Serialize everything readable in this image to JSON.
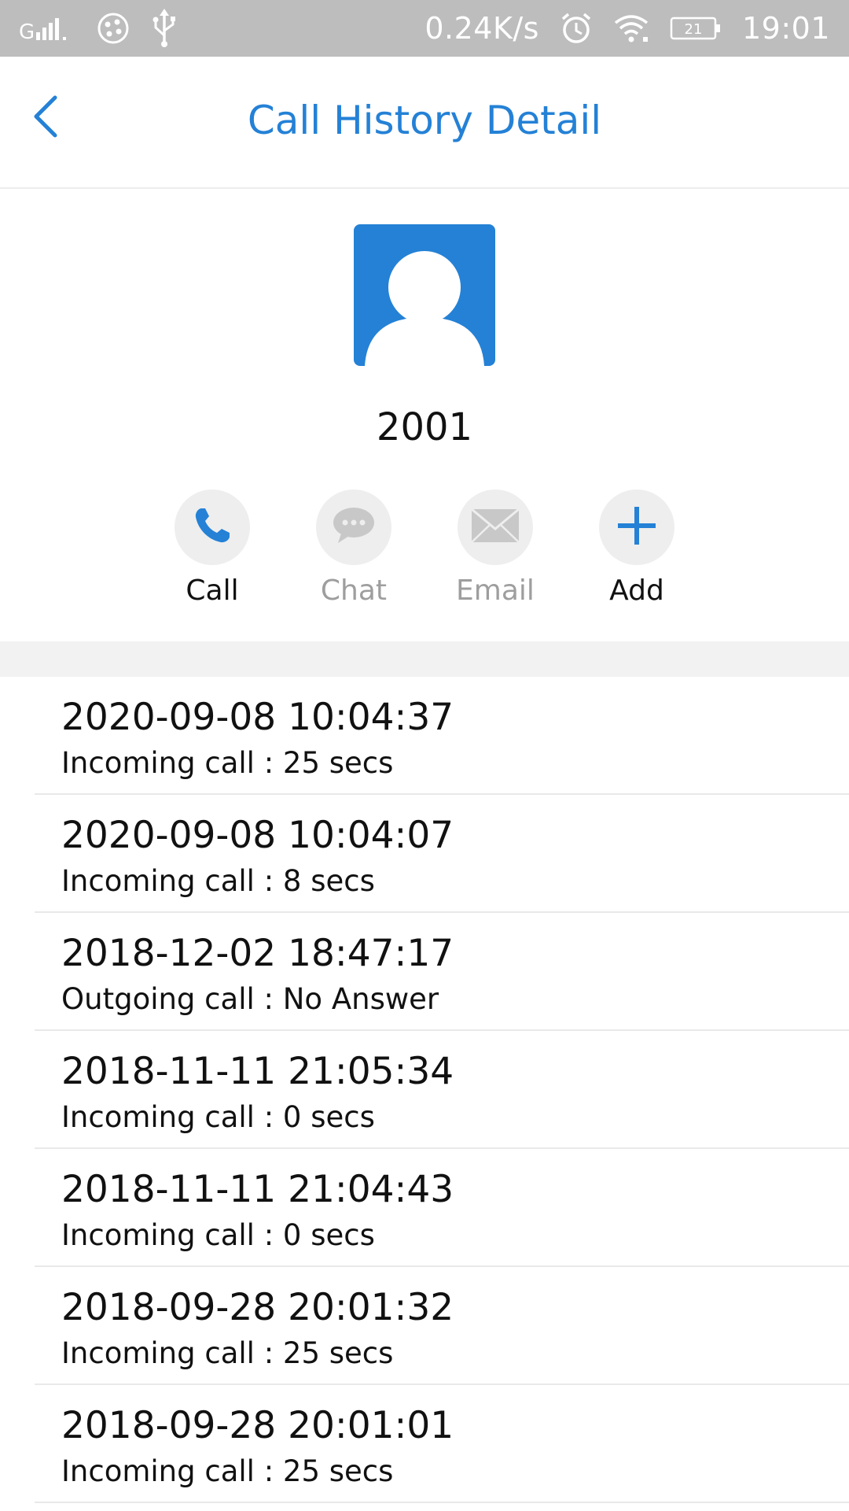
{
  "status_bar": {
    "signal_icon": "signal-icon",
    "app_icon": "app-notification-icon",
    "usb_icon": "usb-icon",
    "net_speed": "0.24K/s",
    "alarm_icon": "alarm-icon",
    "wifi_icon": "wifi-icon",
    "battery_level": "21",
    "time": "19:01"
  },
  "header": {
    "back_icon": "back-chevron-icon",
    "title": "Call History Detail"
  },
  "contact": {
    "avatar_icon": "person-avatar-icon",
    "name": "2001"
  },
  "actions": [
    {
      "label": "Call",
      "icon": "phone-icon",
      "enabled": true
    },
    {
      "label": "Chat",
      "icon": "chat-bubble-icon",
      "enabled": false
    },
    {
      "label": "Email",
      "icon": "envelope-icon",
      "enabled": false
    },
    {
      "label": "Add",
      "icon": "plus-icon",
      "enabled": true
    }
  ],
  "history": [
    {
      "datetime": "2020-09-08 10:04:37",
      "detail": "Incoming call : 25 secs"
    },
    {
      "datetime": "2020-09-08 10:04:07",
      "detail": "Incoming call : 8 secs"
    },
    {
      "datetime": "2018-12-02 18:47:17",
      "detail": "Outgoing call : No Answer"
    },
    {
      "datetime": "2018-11-11 21:05:34",
      "detail": "Incoming call : 0 secs"
    },
    {
      "datetime": "2018-11-11 21:04:43",
      "detail": "Incoming call : 0 secs"
    },
    {
      "datetime": "2018-09-28 20:01:32",
      "detail": "Incoming call : 25 secs"
    },
    {
      "datetime": "2018-09-28 20:01:01",
      "detail": "Incoming call : 25 secs"
    }
  ],
  "colors": {
    "accent": "#2481d6",
    "status_bar": "#bdbdbd",
    "disabled_text": "#9e9e9e",
    "circle_bg": "#eeeeee"
  }
}
